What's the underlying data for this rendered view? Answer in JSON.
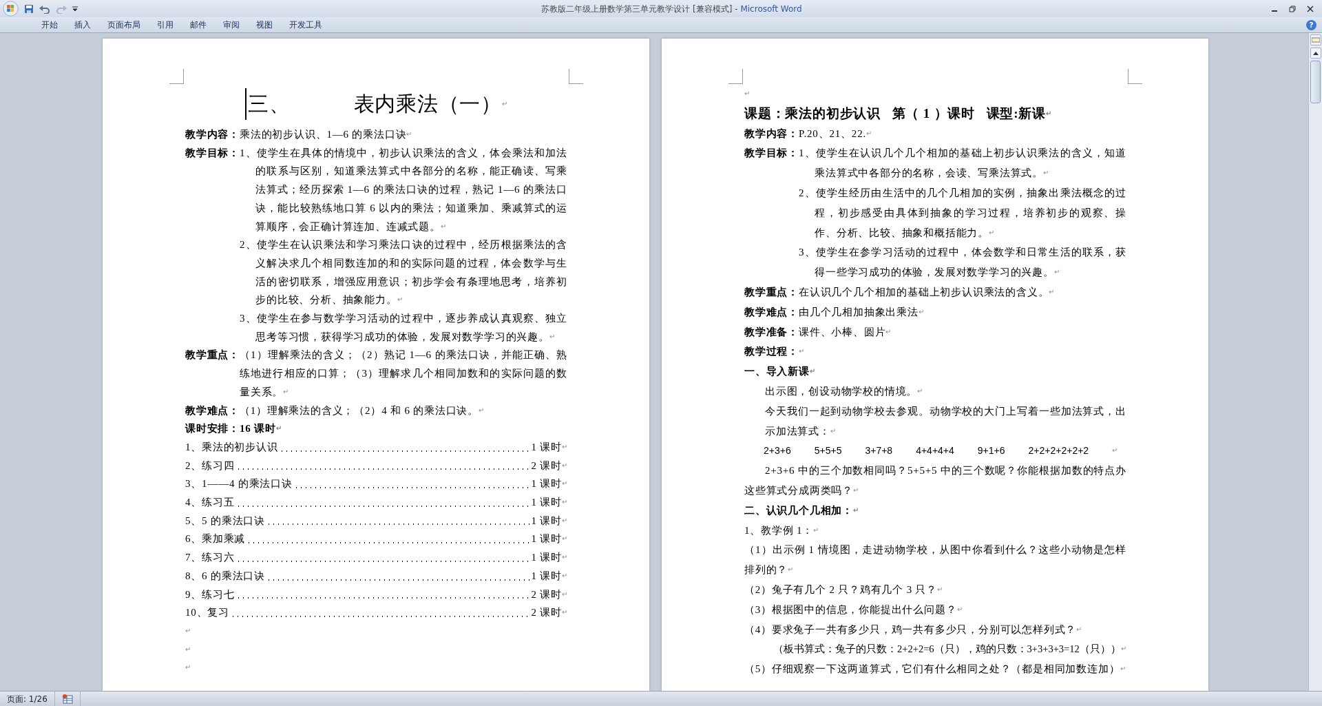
{
  "window": {
    "title": "苏教版二年级上册数学第三单元教学设计 [兼容模式] - ",
    "app": "Microsoft Word"
  },
  "ribbon_tabs": [
    "开始",
    "插入",
    "页面布局",
    "引用",
    "邮件",
    "审阅",
    "视图",
    "开发工具"
  ],
  "help": "?",
  "pages": [
    {
      "blocks": [
        {
          "kind": "title",
          "number": "三、",
          "text": "表内乘法（一）",
          "mark": "↵"
        },
        {
          "kind": "field",
          "label": "教学内容：",
          "paragraphs": [
            {
              "text": "乘法的初步认识、1—6 的乘法口诀",
              "mark": "↵"
            }
          ]
        },
        {
          "kind": "field",
          "label": "教学目标：",
          "paragraphs": [
            {
              "text": "1、使学生在具体的情境中，初步认识乘法的含义，体会乘法和加法的联系与区别，知道乘法算式中各部分的名称，能正确读、写乘法算式；经历探索 1—6 的乘法口诀的过程，熟记 1—6 的乘法口诀，能比较熟练地口算 6 以内的乘法；知道乘加、乘减算式的运算顺序，会正确计算连加、连减式题。",
              "hanging": true,
              "mark": "↵"
            },
            {
              "text": "2、使学生在认识乘法和学习乘法口诀的过程中，经历根据乘法的含义解决求几个相同数连加的和的实际问题的过程，体会数学与生活的密切联系，增强应用意识；初步学会有条理地思考，培养初步的比较、分析、抽象能力。",
              "hanging": true,
              "mark": "↵"
            },
            {
              "text": "3、使学生在参与数学学习活动的过程中，逐步养成认真观察、独立思考等习惯，获得学习成功的体验，发展对数学学习的兴趣。",
              "hanging": true,
              "mark": "↵"
            }
          ]
        },
        {
          "kind": "field",
          "label": "教学重点：",
          "paragraphs": [
            {
              "text": "（1）理解乘法的含义；（2）熟记 1—6 的乘法口诀，并能正确、熟练地进行相应的口算；（3）理解求几个相同加数和的实际问题的数量关系。",
              "hanging": false,
              "mark": "↵"
            }
          ]
        },
        {
          "kind": "field",
          "label": "教学难点：",
          "paragraphs": [
            {
              "text": "（1）理解乘法的含义；（2）4 和 6 的乘法口诀。",
              "mark": "↵"
            }
          ]
        },
        {
          "kind": "strong",
          "text": "课时安排：16 课时",
          "mark": "↵"
        },
        {
          "kind": "toc",
          "text": "1、乘法的初步认识",
          "value": "1 课时",
          "mark": "↵"
        },
        {
          "kind": "toc",
          "text": "2、练习四",
          "value": "2 课时",
          "mark": "↵"
        },
        {
          "kind": "toc",
          "text": "3、1——4 的乘法口诀",
          "value": "1 课时",
          "mark": "↵"
        },
        {
          "kind": "toc",
          "text": "4、练习五",
          "value": "1 课时",
          "mark": "↵"
        },
        {
          "kind": "toc",
          "text": "5、5 的乘法口诀",
          "value": "1 课时",
          "mark": "↵"
        },
        {
          "kind": "toc",
          "text": "6、乘加乘减",
          "value": "1 课时",
          "mark": "↵"
        },
        {
          "kind": "toc",
          "text": "7、练习六",
          "value": "1 课时",
          "mark": "↵"
        },
        {
          "kind": "toc",
          "text": "8、6 的乘法口诀",
          "value": "1 课时",
          "mark": "↵"
        },
        {
          "kind": "toc",
          "text": "9、练习七",
          "value": "2 课时",
          "mark": "↵"
        },
        {
          "kind": "toc",
          "text": "10、复习",
          "value": "2 课时",
          "mark": "↵"
        },
        {
          "kind": "blank",
          "mark": "↵"
        },
        {
          "kind": "blank",
          "mark": "↵"
        },
        {
          "kind": "blank",
          "mark": "↵"
        }
      ]
    },
    {
      "blocks": [
        {
          "kind": "blank",
          "mark": "↵"
        },
        {
          "kind": "heading",
          "text": "课题：乘法的初步认识   第（ 1 ）课时   课型:新课",
          "mark": "↵"
        },
        {
          "kind": "field",
          "label": "教学内容：",
          "paragraphs": [
            {
              "text": "P.20、21、22.",
              "mark": "↵"
            }
          ]
        },
        {
          "kind": "field",
          "label": "教学目标：",
          "paragraphs": [
            {
              "text": "1、使学生在认识几个几个相加的基础上初步认识乘法的含义，知道乘法算式中各部分的名称，会读、写乘法算式。",
              "hanging": true,
              "mark": "↵"
            },
            {
              "text": "2、使学生经历由生活中的几个几相加的实例，抽象出乘法概念的过程，初步感受由具体到抽象的学习过程，培养初步的观察、操作、分析、比较、抽象和概括能力。",
              "hanging": true,
              "mark": "↵"
            },
            {
              "text": "3、使学生在参学习活动的过程中，体会数学和日常生活的联系，获得一些学习成功的体验，发展对数学学习的兴趣。",
              "hanging": true,
              "mark": "↵"
            }
          ]
        },
        {
          "kind": "field",
          "label": "教学重点：",
          "paragraphs": [
            {
              "text": "在认识几个几个相加的基础上初步认识乘法的含义。",
              "mark": "↵"
            }
          ]
        },
        {
          "kind": "field",
          "label": "教学难点：",
          "paragraphs": [
            {
              "text": "由几个几相加抽象出乘法",
              "mark": "↵"
            }
          ]
        },
        {
          "kind": "field",
          "label": "教学准备：",
          "paragraphs": [
            {
              "text": "课件、小棒、圆片",
              "mark": "↵"
            }
          ]
        },
        {
          "kind": "field",
          "label": "教学过程：",
          "paragraphs": [
            {
              "mark": "↵"
            }
          ]
        },
        {
          "kind": "strong",
          "text": "一、导入新课",
          "mark": "↵"
        },
        {
          "kind": "indent",
          "text": "出示图，创设动物学校的情境。",
          "mark": "↵"
        },
        {
          "kind": "indent",
          "text": "今天我们一起到动物学校去参观。动物学校的大门上写着一些加法算式，出示加法算式：",
          "mark": "↵"
        },
        {
          "kind": "formulas",
          "items": [
            "2+3+6",
            "5+5+5",
            "3+7+8",
            "4+4+4+4",
            "9+1+6",
            "2+2+2+2+2+2"
          ],
          "mark": "↵"
        },
        {
          "kind": "first-indent",
          "text": "2+3+6 中的三个加数相同吗？5+5+5 中的三个数呢？你能根据加数的特点办这些算式分成两类吗？",
          "mark": "↵"
        },
        {
          "kind": "strong",
          "text": "二、认识几个几相加：",
          "mark": "↵"
        },
        {
          "kind": "plain",
          "text": "1、教学例 1：",
          "mark": "↵"
        },
        {
          "kind": "plain",
          "text": "（1）出示例 1 情境图，走进动物学校，从图中你看到什么？这些小动物是怎样排列的？",
          "mark": "↵"
        },
        {
          "kind": "plain",
          "text": "（2）兔子有几个 2 只？鸡有几个 3 只？",
          "mark": "↵"
        },
        {
          "kind": "plain",
          "text": "（3）根据图中的信息，你能提出什么问题？",
          "mark": "↵"
        },
        {
          "kind": "plain",
          "text": "（4）要求兔子一共有多少只，鸡一共有多少只，分别可以怎样列式？",
          "mark": "↵"
        },
        {
          "kind": "note",
          "text": "（板书算式：兔子的只数：2+2+2=6（只），鸡的只数：3+3+3+3=12（只））",
          "mark": "↵"
        },
        {
          "kind": "plain",
          "text": "（5）仔细观察一下这两道算式，它们有什么相同之处？（都是相同加数连加）",
          "mark": "↵"
        }
      ]
    }
  ],
  "status_bar": {
    "page": "页面: 1/26"
  }
}
